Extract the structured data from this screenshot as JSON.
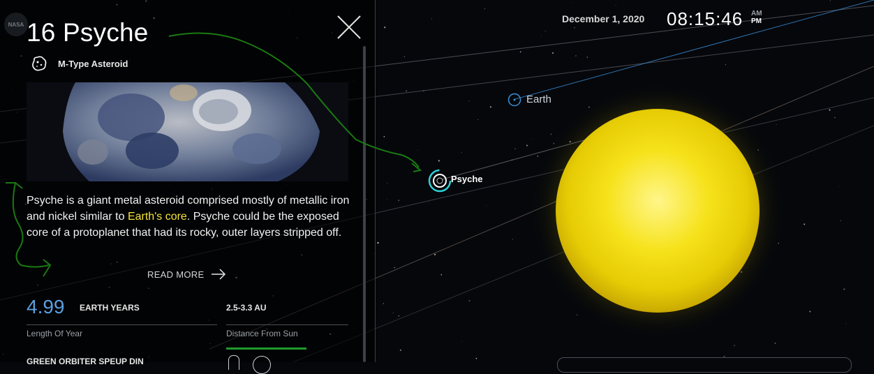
{
  "header": {
    "logo": "NASA",
    "date": "December 1, 2020",
    "time": "08:15:46",
    "am": "AM",
    "pm": "PM"
  },
  "panel": {
    "title": "16 Psyche",
    "type_icon": "asteroid-icon",
    "type": "M-Type Asteroid",
    "description_parts": {
      "p1": "Psyche is a giant metal asteroid comprised mostly of metallic iron and nickel similar to ",
      "highlight": "Earth's core",
      "p2": ". Psyche could be the exposed core of a protoplanet that had its rocky, outer layers stripped off."
    },
    "read_more": "READ MORE",
    "stats": {
      "year_value": "4.99",
      "year_unit": "EARTH YEARS",
      "year_label": "Length Of Year",
      "distance_value": "2.5-3.3 AU",
      "distance_label": "Distance From Sun"
    },
    "cut_text": "GREEN ORBITER SPEUP DIN"
  },
  "scene": {
    "earth_label": "Earth",
    "psyche_label": "Psyche"
  },
  "colors": {
    "accent_blue": "#5b9fe0",
    "highlight_yellow": "#f5e43a",
    "active_green": "#1e9a2e",
    "annotation_green": "#1a7a12",
    "sun": "#f7e21a"
  }
}
